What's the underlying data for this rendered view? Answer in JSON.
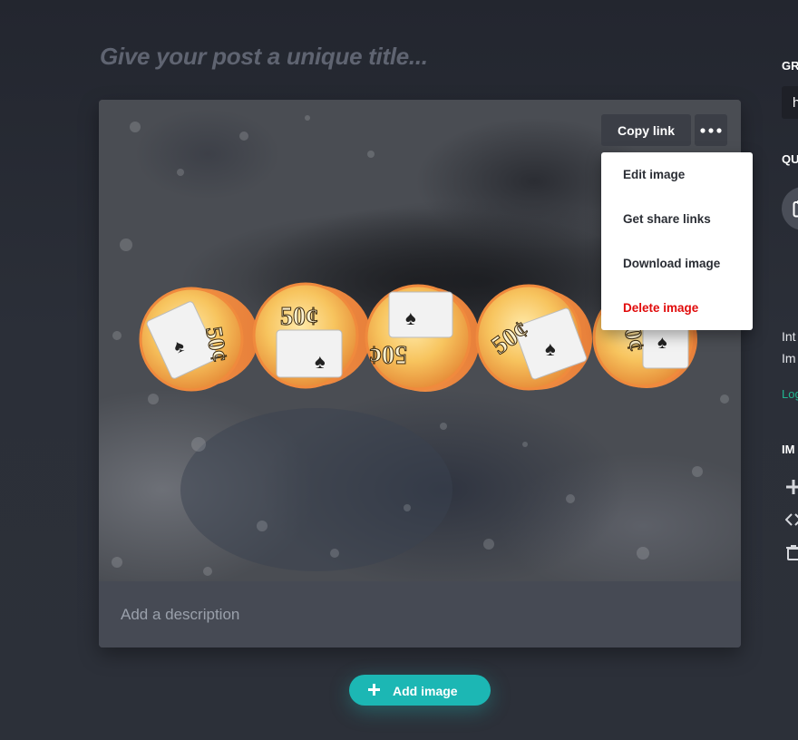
{
  "post": {
    "title_placeholder": "Give your post a unique title...",
    "description_placeholder": "Add a description"
  },
  "image_toolbar": {
    "copy_link_label": "Copy link",
    "more_icon": "more-horizontal-icon"
  },
  "image_menu": {
    "items": [
      {
        "label": "Edit image"
      },
      {
        "label": "Get share links"
      },
      {
        "label": "Download image"
      },
      {
        "label": "Delete image",
        "style": "danger",
        "color": "#e10c0c"
      }
    ]
  },
  "image": {
    "chip_denomination": "50¢",
    "chip_count": 5
  },
  "add_image": {
    "label": "Add image",
    "icon": "plus-icon",
    "color": "#1cb7b4"
  },
  "sidebar": {
    "section1_label": "GR",
    "section1_field_value": "h",
    "section2_label": "QU",
    "section2_button_icon": "clipboard-icon",
    "info_line1": "Int",
    "info_line2": "Im",
    "link_text": "Log",
    "link_color": "#1fb58f",
    "section3_label": "IM",
    "tool_icons": [
      "plus-icon",
      "code-icon",
      "trash-icon"
    ]
  }
}
